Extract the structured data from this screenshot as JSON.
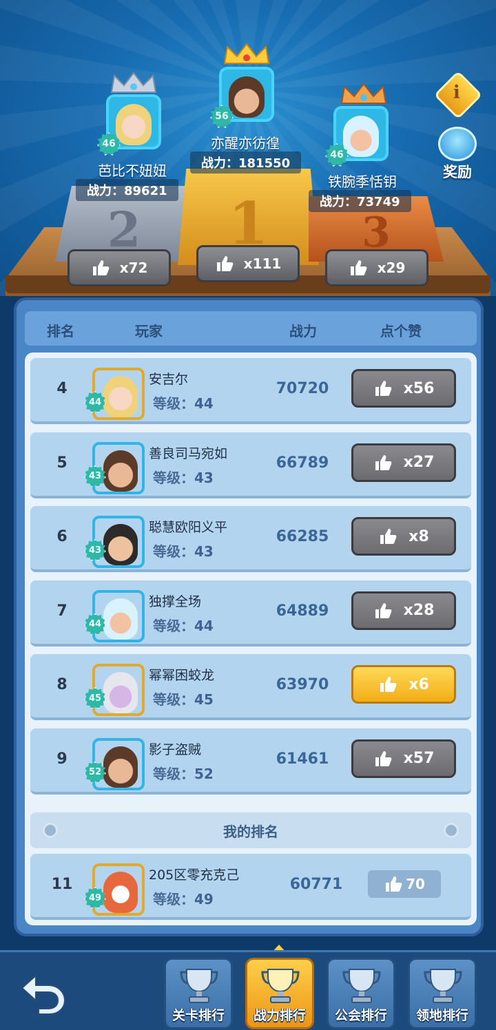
{
  "colors": {
    "accent_gold": "#f2ae16",
    "teal_badge": "#2fb7a8",
    "panel_blue": "#4a86c6",
    "row_blue": "#b3d4ef"
  },
  "podium": {
    "first": {
      "name": "亦醒亦彷徨",
      "level": "56",
      "power": "战力：181550",
      "likes": "x111",
      "place": "1"
    },
    "second": {
      "name": "芭比不妞妞",
      "level": "46",
      "power": "战力：89621",
      "likes": "x72",
      "place": "2"
    },
    "third": {
      "name": "铁腕季恬钥",
      "level": "46",
      "power": "战力：73749",
      "likes": "x29",
      "place": "3"
    }
  },
  "side": {
    "info_icon": "i",
    "reward_label": "奖励"
  },
  "table": {
    "headers": {
      "rank": "排名",
      "player": "玩家",
      "power": "战力",
      "like": "点个赞"
    },
    "rows": [
      {
        "rank": "4",
        "name": "安吉尔",
        "level_label": "等级：",
        "level": "44",
        "power": "70720",
        "likes": "x56",
        "active": false
      },
      {
        "rank": "5",
        "name": "善良司马宛如",
        "level_label": "等级：",
        "level": "43",
        "power": "66789",
        "likes": "x27",
        "active": false
      },
      {
        "rank": "6",
        "name": "聪慧欧阳义平",
        "level_label": "等级：",
        "level": "43",
        "power": "66285",
        "likes": "x8",
        "active": false
      },
      {
        "rank": "7",
        "name": "独撑全场",
        "level_label": "等级：",
        "level": "44",
        "power": "64889",
        "likes": "x28",
        "active": false
      },
      {
        "rank": "8",
        "name": "幂幂困蛟龙",
        "level_label": "等级：",
        "level": "45",
        "power": "63970",
        "likes": "x6",
        "active": true
      },
      {
        "rank": "9",
        "name": "影子盗贼",
        "level_label": "等级：",
        "level": "52",
        "power": "61461",
        "likes": "x57",
        "active": false
      }
    ],
    "my_rank_label": "我的排名",
    "mine": {
      "rank": "11",
      "name": "205区零充克己",
      "level_label": "等级：",
      "level": "49",
      "power": "60771",
      "likes": "70"
    }
  },
  "nav": {
    "tabs": [
      {
        "label": "关卡排行",
        "active": false
      },
      {
        "label": "战力排行",
        "active": true
      },
      {
        "label": "公会排行",
        "active": false
      },
      {
        "label": "领地排行",
        "active": false
      }
    ]
  }
}
